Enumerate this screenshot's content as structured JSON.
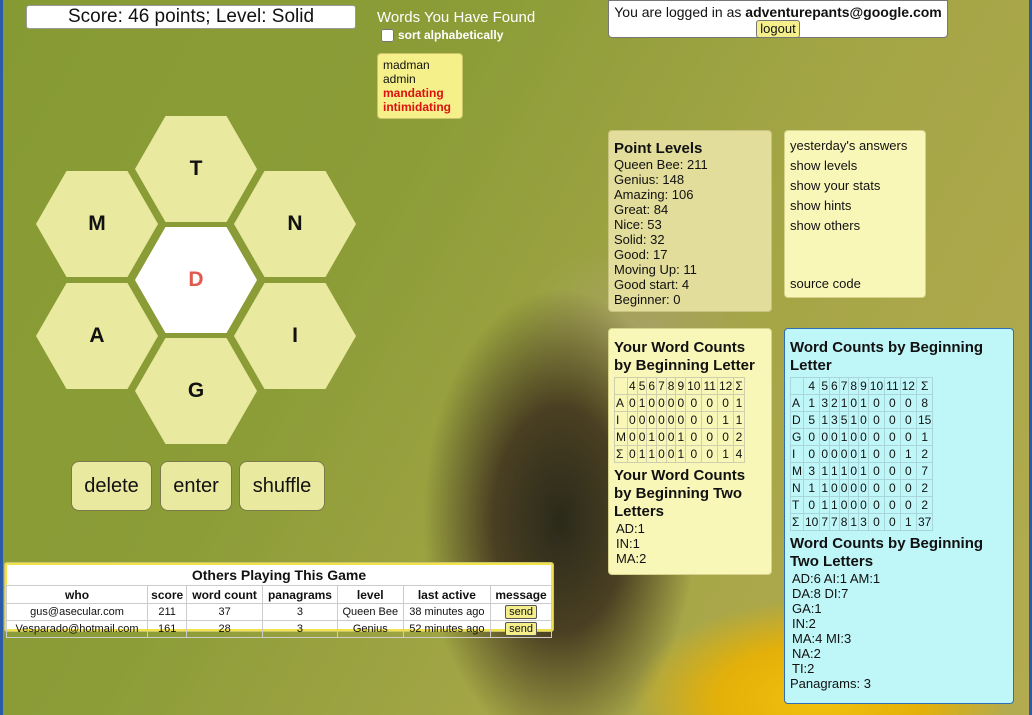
{
  "score_text": "Score: 46 points; Level: Solid",
  "found": {
    "title": "Words You Have Found",
    "sort_label": "sort alphabetically",
    "words": [
      {
        "w": "madman",
        "pangram": false
      },
      {
        "w": "admin",
        "pangram": false
      },
      {
        "w": "mandating",
        "pangram": true
      },
      {
        "w": "intimidating",
        "pangram": true
      }
    ]
  },
  "letters": {
    "top": "T",
    "upper_left": "M",
    "upper_right": "N",
    "center": "D",
    "lower_left": "A",
    "lower_right": "I",
    "bottom": "G"
  },
  "buttons": {
    "delete": "delete",
    "enter": "enter",
    "shuffle": "shuffle"
  },
  "login": {
    "prefix": "You are logged in as",
    "email": "adventurepants@google.com",
    "logout": "logout"
  },
  "levels": {
    "title": "Point Levels",
    "items": [
      "Queen Bee: 211",
      "Genius: 148",
      "Amazing: 106",
      "Great: 84",
      "Nice: 53",
      "Solid: 32",
      "Good: 17",
      "Moving Up: 11",
      "Good start: 4",
      "Beginner: 0"
    ]
  },
  "links": {
    "yesterday": "yesterday's answers",
    "levels": "show levels",
    "stats": "show your stats",
    "hints": "show hints",
    "others": "show others",
    "source": "source code"
  },
  "your_counts": {
    "title": "Your Word Counts by Beginning Letter",
    "header": [
      "",
      "4",
      "5",
      "6",
      "7",
      "8",
      "9",
      "10",
      "11",
      "12",
      "Σ"
    ],
    "rows": [
      [
        "A",
        "0",
        "1",
        "0",
        "0",
        "0",
        "0",
        "0",
        "0",
        "0",
        "1"
      ],
      [
        "I",
        "0",
        "0",
        "0",
        "0",
        "0",
        "0",
        "0",
        "0",
        "1",
        "1"
      ],
      [
        "M",
        "0",
        "0",
        "1",
        "0",
        "0",
        "1",
        "0",
        "0",
        "0",
        "2"
      ],
      [
        "Σ",
        "0",
        "1",
        "1",
        "0",
        "0",
        "1",
        "0",
        "0",
        "1",
        "4"
      ]
    ],
    "two_title": "Your Word Counts by Beginning Two Letters",
    "two_lines": [
      "AD:1",
      "IN:1",
      "MA:2"
    ]
  },
  "all_counts": {
    "title": "Word Counts by Beginning Letter",
    "header": [
      "",
      "4",
      "5",
      "6",
      "7",
      "8",
      "9",
      "10",
      "11",
      "12",
      "Σ"
    ],
    "rows": [
      [
        "A",
        "1",
        "3",
        "2",
        "1",
        "0",
        "1",
        "0",
        "0",
        "0",
        "8"
      ],
      [
        "D",
        "5",
        "1",
        "3",
        "5",
        "1",
        "0",
        "0",
        "0",
        "0",
        "15"
      ],
      [
        "G",
        "0",
        "0",
        "0",
        "1",
        "0",
        "0",
        "0",
        "0",
        "0",
        "1"
      ],
      [
        "I",
        "0",
        "0",
        "0",
        "0",
        "0",
        "1",
        "0",
        "0",
        "1",
        "2"
      ],
      [
        "M",
        "3",
        "1",
        "1",
        "1",
        "0",
        "1",
        "0",
        "0",
        "0",
        "7"
      ],
      [
        "N",
        "1",
        "1",
        "0",
        "0",
        "0",
        "0",
        "0",
        "0",
        "0",
        "2"
      ],
      [
        "T",
        "0",
        "1",
        "1",
        "0",
        "0",
        "0",
        "0",
        "0",
        "0",
        "2"
      ],
      [
        "Σ",
        "10",
        "7",
        "7",
        "8",
        "1",
        "3",
        "0",
        "0",
        "1",
        "37"
      ]
    ],
    "two_title": "Word Counts by Beginning Two Letters",
    "two_lines": [
      "AD:6 AI:1 AM:1",
      "DA:8 DI:7",
      "GA:1",
      "IN:2",
      "MA:4 MI:3",
      "NA:2",
      "TI:2"
    ],
    "panagrams": "Panagrams: 3"
  },
  "others": {
    "title": "Others Playing This Game",
    "columns": [
      "who",
      "score",
      "word count",
      "panagrams",
      "level",
      "last active",
      "message"
    ],
    "rows": [
      {
        "who": "gus@asecular.com",
        "score": "211",
        "words": "37",
        "pan": "3",
        "level": "Queen Bee",
        "active": "38 minutes ago",
        "msg": "send"
      },
      {
        "who": "Vesparado@hotmail.com",
        "score": "161",
        "words": "28",
        "pan": "3",
        "level": "Genius",
        "active": "52 minutes ago",
        "msg": "send"
      }
    ]
  }
}
